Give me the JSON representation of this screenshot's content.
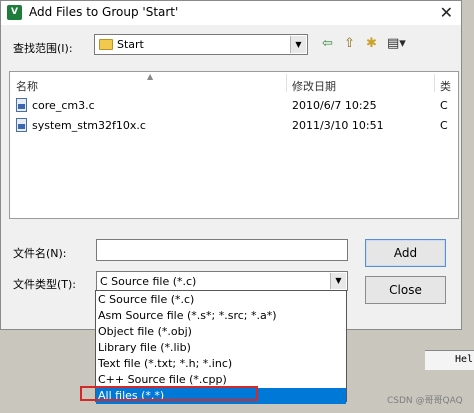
{
  "window": {
    "title": "Add Files to Group 'Start'",
    "app_icon_text": "V",
    "close_glyph": "✕"
  },
  "lookin": {
    "label": "查找范围(I):",
    "value": "Start"
  },
  "toolbar": {
    "back_glyph": "⇦",
    "up_glyph": "⇧",
    "newfolder_glyph": "✱",
    "view_glyph": "▤▾"
  },
  "filelist": {
    "columns": [
      "名称",
      "修改日期",
      "类"
    ],
    "rows": [
      {
        "name": "core_cm3.c",
        "date": "2010/6/7 10:25",
        "type": "C"
      },
      {
        "name": "system_stm32f10x.c",
        "date": "2011/3/10 10:51",
        "type": "C"
      }
    ]
  },
  "filename": {
    "label": "文件名(N):",
    "value": ""
  },
  "filetype": {
    "label": "文件类型(T):",
    "selected": "C Source file (*.c)",
    "options": [
      "C Source file (*.c)",
      "Asm Source file (*.s*; *.src; *.a*)",
      "Object file (*.obj)",
      "Library file (*.lib)",
      "Text file (*.txt; *.h; *.inc)",
      "C++ Source file (*.cpp)",
      "All files (*.*)"
    ],
    "highlighted": "All files (*.*)"
  },
  "buttons": {
    "add": "Add",
    "close": "Close"
  },
  "background": {
    "hel_text": "Hel"
  },
  "watermark": "CSDN @哥哥QAQ",
  "colors": {
    "selection": "#0078d7",
    "annotation_box": "#d62828"
  }
}
